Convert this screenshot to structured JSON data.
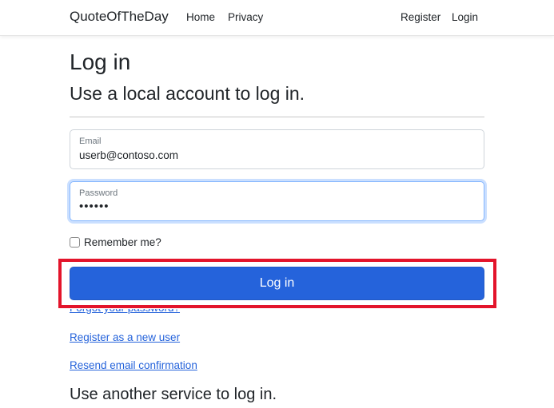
{
  "navbar": {
    "brand": "QuoteOfTheDay",
    "left_links": [
      "Home",
      "Privacy"
    ],
    "right_links": [
      "Register",
      "Login"
    ]
  },
  "page": {
    "title": "Log in",
    "subtitle": "Use a local account to log in.",
    "other_service_heading": "Use another service to log in."
  },
  "form": {
    "email": {
      "label": "Email",
      "value": "userb@contoso.com"
    },
    "password": {
      "label": "Password",
      "value": "••••••"
    },
    "remember_label": "Remember me?",
    "submit_label": "Log in"
  },
  "links": {
    "forgot": "Forgot your password?",
    "register": "Register as a new user",
    "resend": "Resend email confirmation"
  },
  "colors": {
    "primary": "#2563db",
    "highlight": "#e3142b",
    "focus_border": "#86b7fe"
  }
}
